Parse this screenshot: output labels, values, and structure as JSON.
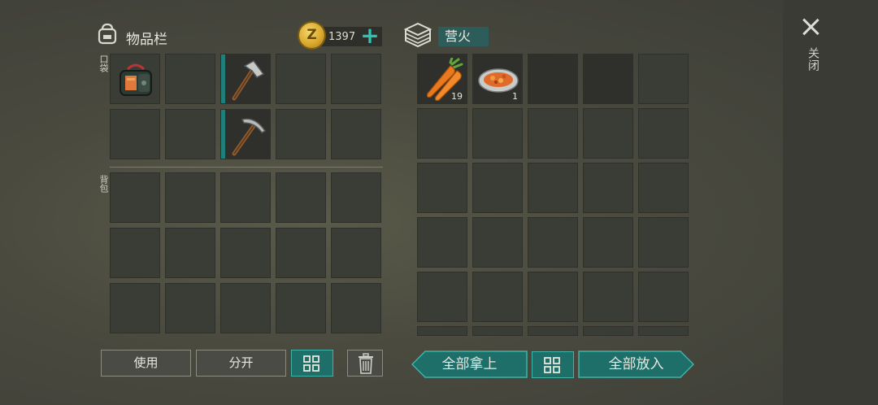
{
  "inventory": {
    "title": "物品栏",
    "coins": "1397",
    "plus_label": "+",
    "coin_glyph": "Z",
    "pockets_label": "口袋",
    "backpack_label": "背包"
  },
  "container": {
    "name": "营火",
    "items": [
      {
        "name": "carrot",
        "count": "19"
      },
      {
        "name": "cooked-stew",
        "count": "1"
      }
    ]
  },
  "pockets": {
    "items": [
      {
        "name": "tool-bag",
        "equipped": false
      },
      {
        "name": "hatchet",
        "equipped": true
      },
      {
        "name": "pickaxe",
        "equipped": true
      }
    ]
  },
  "buttons": {
    "use": "使用",
    "split": "分开",
    "take_all": "全部拿上",
    "put_all": "全部放入"
  },
  "close": {
    "label": "关闭"
  },
  "colors": {
    "accent": "#2ec4b4",
    "teal_button": "#1e6e6a",
    "background": "#4a4a3f"
  },
  "icons": [
    "backpack-icon",
    "coin-icon",
    "plus-icon",
    "storage-icon",
    "close-icon",
    "sort-icon",
    "trash-icon"
  ]
}
